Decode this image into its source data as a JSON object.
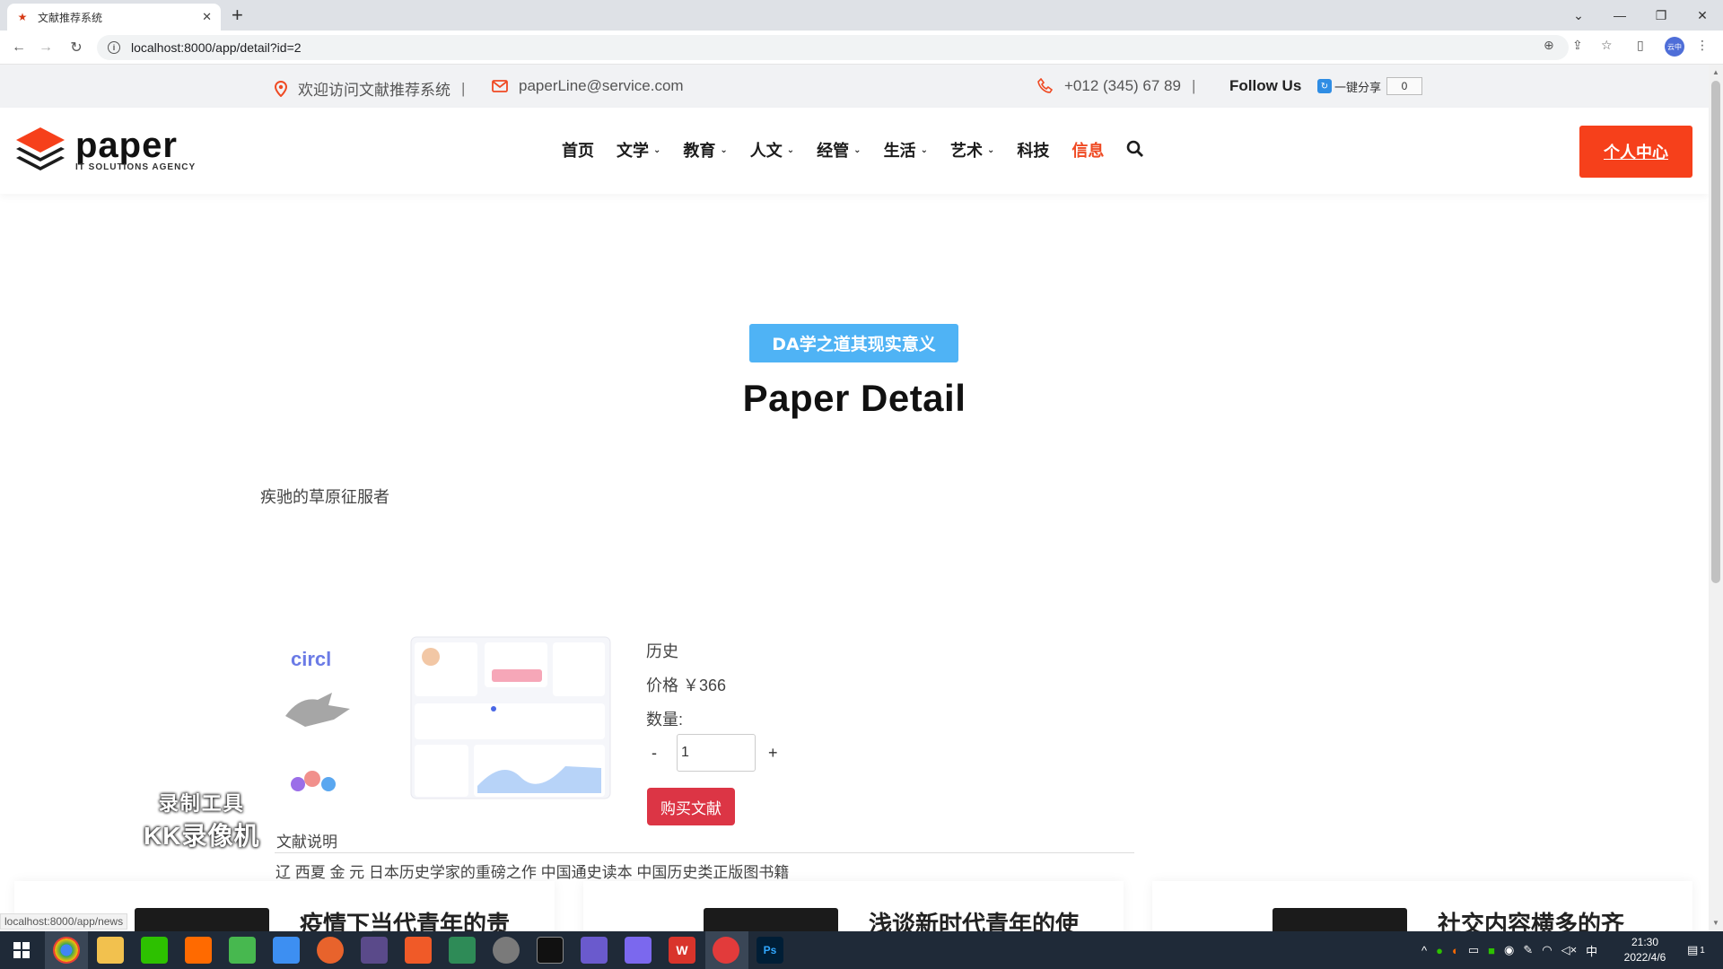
{
  "browser": {
    "tab_title": "文献推荐系统",
    "url": "localhost:8000/app/detail?id=2",
    "status_url": "localhost:8000/app/news",
    "profile_label": "云中"
  },
  "topbar": {
    "welcome": "欢迎访问文献推荐系统",
    "email": "paperLine@service.com",
    "phone": "+012 (345) 67 89",
    "separator": "|",
    "follow": "Follow Us",
    "share_label": "一键分享",
    "share_count": "0"
  },
  "header": {
    "brand": "paper",
    "tagline": "IT SOLUTIONS AGENCY",
    "nav": [
      {
        "label": "首页"
      },
      {
        "label": "文学"
      },
      {
        "label": "教育"
      },
      {
        "label": "人文"
      },
      {
        "label": "经管"
      },
      {
        "label": "生活"
      },
      {
        "label": "艺术"
      },
      {
        "label": "科技"
      },
      {
        "label": "信息"
      }
    ],
    "personal_center": "个人中心"
  },
  "hero": {
    "badge": "DA学之道其现实意义",
    "title": "Paper Detail"
  },
  "paper": {
    "subtitle": "疾驰的草原征服者",
    "image_caption": "circl",
    "category": "历史",
    "price_label": "价格",
    "price": "￥366",
    "qty_label": "数量:",
    "qty_minus": "-",
    "qty_value": "1",
    "qty_plus": "+",
    "buy_label": "购买文献",
    "desc_label": "文献说明",
    "desc": "辽 西夏 金 元 日本历史学家的重磅之作 中国通史读本 中国历史类正版图书籍"
  },
  "watermark": {
    "line1": "录制工具",
    "line2": "KK录像机"
  },
  "cards": [
    {
      "title": "疫情下当代青年的责"
    },
    {
      "title": "浅谈新时代青年的使"
    },
    {
      "title": "社交内容横多的齐"
    }
  ],
  "taskbar": {
    "time": "21:30",
    "date": "2022/4/6",
    "ime": "中",
    "notification_count": "1"
  },
  "colors": {
    "accent": "#f6401b",
    "badge_blue": "#4fb3f5",
    "buy_red": "#dc3545"
  }
}
